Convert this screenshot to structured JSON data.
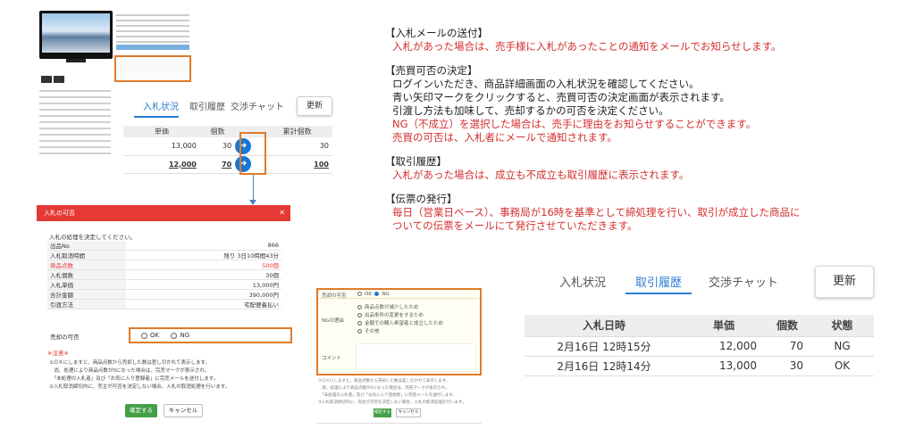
{
  "left_panel": {
    "tabs": [
      "入札状況",
      "取引履歴",
      "交渉チャット"
    ],
    "refresh": "更新",
    "table": {
      "headers": [
        "単価",
        "個数",
        "累計個数"
      ],
      "rows": [
        {
          "price": "13,000",
          "qty": "30",
          "total": "30"
        },
        {
          "price": "12,000",
          "qty": "70",
          "total": "100"
        }
      ]
    }
  },
  "dialog": {
    "title": "入札の可否",
    "close": "✕",
    "intro": "入札の処理を決定してください。",
    "rows": [
      {
        "k": "出品No",
        "v": "866"
      },
      {
        "k": "入札取消時間",
        "v": "残り 3日10時間43分"
      },
      {
        "k": "商品点数",
        "v": "500個"
      },
      {
        "k": "入札個数",
        "v": "30個"
      },
      {
        "k": "入札単価",
        "v": "13,000円"
      },
      {
        "k": "合計金額",
        "v": "390,000円"
      },
      {
        "k": "引渡方法",
        "v": "宅配便着払い"
      }
    ],
    "sale_label": "売却の可否",
    "opt_ok": "OK",
    "opt_ng": "NG",
    "note_head": "※注意※",
    "notes": [
      "①ＯＫにしますと、商品点数から売却した数は差し引かれて表示します。",
      "　尚、処理により商品点数が0になった場合は、完売マークが表示され、",
      "　「未処理の入札者」及び「お気に入り登録者」に完売メールを送付します。",
      "②入札取消締切内に、売主が可否を決定しない場合、入札の取消処理を行います。"
    ],
    "btn_ok": "確定する",
    "btn_cancel": "キャンセル"
  },
  "ng_panel": {
    "label_decision": "売却の可否",
    "ok": "OK",
    "ng": "NG",
    "label_reason": "NGの理由",
    "reasons": [
      "商品点数が減少したため",
      "出品条件の変更をするため",
      "金額での購入希望者と成立したため",
      "その他"
    ],
    "label_comment": "コメント",
    "btn_ok": "確定する",
    "btn_cancel": "キャンセル"
  },
  "explanation": [
    {
      "type": "h",
      "text": "【入札メールの送付】"
    },
    {
      "type": "r",
      "text": "入札があった場合は、売手様に入札があったことの通知をメールでお知らせします。"
    },
    {
      "type": "gap"
    },
    {
      "type": "h",
      "text": "【売買可否の決定】"
    },
    {
      "type": "b",
      "text": "ログインいただき、商品詳細画面の入札状況を確認してください。"
    },
    {
      "type": "b",
      "text": "青い矢印マークをクリックすると、売買可否の決定画面が表示されます。"
    },
    {
      "type": "b",
      "text": "引渡し方法も加味して、売却するかの可否を決定ください。"
    },
    {
      "type": "r",
      "text": "NG（不成立）を選択した場合は、売手に理由をお知らせすることができます。"
    },
    {
      "type": "r",
      "text": "売買の可否は、入札者にメールで通知されます。"
    },
    {
      "type": "gap"
    },
    {
      "type": "h",
      "text": "【取引履歴】"
    },
    {
      "type": "r",
      "text": "入札があった場合は、成立も不成立も取引履歴に表示されます。"
    },
    {
      "type": "gap"
    },
    {
      "type": "h",
      "text": "【伝票の発行】"
    },
    {
      "type": "r",
      "text": "毎日（営業日ベース）、事務局が16時を基準として締処理を行い、取引が成立した商品に"
    },
    {
      "type": "r",
      "text": "ついての伝票をメールにて発行させていただきます。"
    }
  ],
  "right_panel": {
    "tabs": [
      "入札状況",
      "取引履歴",
      "交渉チャット"
    ],
    "refresh": "更新",
    "table": {
      "headers": [
        "入札日時",
        "単価",
        "個数",
        "状態"
      ],
      "rows": [
        {
          "date": "2月16日 12時15分",
          "price": "12,000",
          "qty": "70",
          "status": "NG"
        },
        {
          "date": "2月16日 12時14分",
          "price": "13,000",
          "qty": "30",
          "status": "OK"
        }
      ]
    }
  },
  "colors": {
    "accent": "#2b7cd3",
    "highlight": "#e07b2a",
    "danger": "#e53935",
    "ok": "#43a047"
  }
}
